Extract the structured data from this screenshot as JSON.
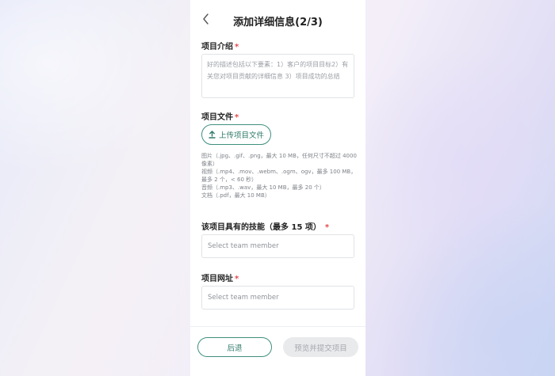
{
  "header": {
    "title": "添加详细信息(2/3)",
    "back_icon": "chevron-left-icon"
  },
  "intro": {
    "label": "项目介绍",
    "required_mark": "*",
    "placeholder": "好的描述包括以下要素：1）客户的项目目标2）有关您对项目贡献的详细信息 3）项目成功的总结"
  },
  "files": {
    "label": "项目文件",
    "required_mark": "*",
    "upload_label": "上传项目文件",
    "upload_icon": "upload-icon",
    "hints": [
      "图片（.jpg、.gif、.png，最大 10 MB，任何尺寸不超过 4000 像素）",
      "视频（.mp4、.mov、.webm、.ogm、ogv，最多 100 MB，最多 2 个，< 60 秒）",
      "音频（.mp3、.wav，最大 10 MB，最多 20 个）",
      "文档（.pdf，最大 10 MB）"
    ]
  },
  "skills": {
    "label": "该项目具有的技能（最多 15 项）",
    "required_mark": "*",
    "placeholder": "Select team member"
  },
  "url": {
    "label": "项目网址",
    "required_mark": "*",
    "placeholder": "Select team member"
  },
  "footer": {
    "back_label": "后退",
    "submit_label": "预览并提交项目"
  },
  "colors": {
    "accent": "#3f8f7e",
    "required": "#e5484d",
    "disabled_bg": "#e9eaec"
  }
}
